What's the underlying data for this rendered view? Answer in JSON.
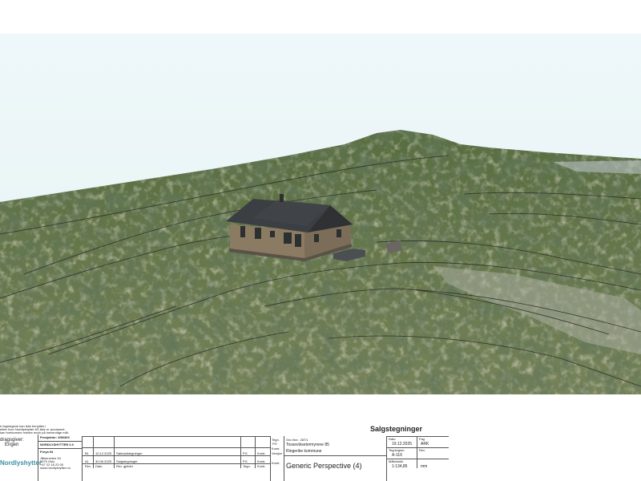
{
  "disclaimer": [
    "e tegningene kan ikke benyttes i",
    "ekter hvor Nordlyshytter AS ikke er produsent.",
    "kan forekomme mindre avvik på innvendige mål."
  ],
  "client": {
    "label": "dragsgiver:",
    "name": "Engen"
  },
  "logo": {
    "text": "Nordlyshytter"
  },
  "project": {
    "number": "Prosjektnr: 305/303",
    "company": "NORDLYSHYTTER 2.0",
    "model": "Freya 94",
    "address_lines": [
      "Jålserveien 94",
      "0579 Oslo",
      "+47 22 16 23 00",
      "www.nordlyshytter.no"
    ]
  },
  "revisions": [
    {
      "rev": "B1",
      "date": "10.12.2025",
      "description": "Søknadstegninger",
      "by": "PG",
      "checked": "Kontr."
    },
    {
      "rev": "A1",
      "date": "30.06.2025",
      "description": "Salgstegninger",
      "by": "PG",
      "checked": "Kontr."
    }
  ],
  "revision_header": {
    "rev": "Rev.",
    "date": "Dato",
    "description": "Rev. gjelder",
    "by": "Tegn.",
    "checked": "Kontr."
  },
  "site": {
    "label_drawn": "Tegn.",
    "drawn": "PG",
    "label_checked": "Kontr.",
    "label_version": "Versjon",
    "gnr": "Gnr./bnr.: 287/1",
    "address": "Tosseviksetermyrene 85",
    "municipality": "Ringerike kommune",
    "label_content": "Kontr."
  },
  "sheet_title": "Salgstegninger",
  "view_name": "Generic Perspective (4)",
  "meta": {
    "date_label": "Dato",
    "date": "19.12.2025",
    "discipline_label": "Fag",
    "discipline": "ARK",
    "drawing_no_label": "Tegningsnr.",
    "drawing_no": "A-116",
    "rev_label": "Rev.",
    "scale_label": "Målestokk",
    "scale": "1:134,85",
    "units": "mm"
  },
  "colors": {
    "sky": "#edf7f8",
    "terrain": "#5d6e43",
    "contour": "#262626",
    "wall": "#8a7b63",
    "roof": "#3a3d40"
  }
}
